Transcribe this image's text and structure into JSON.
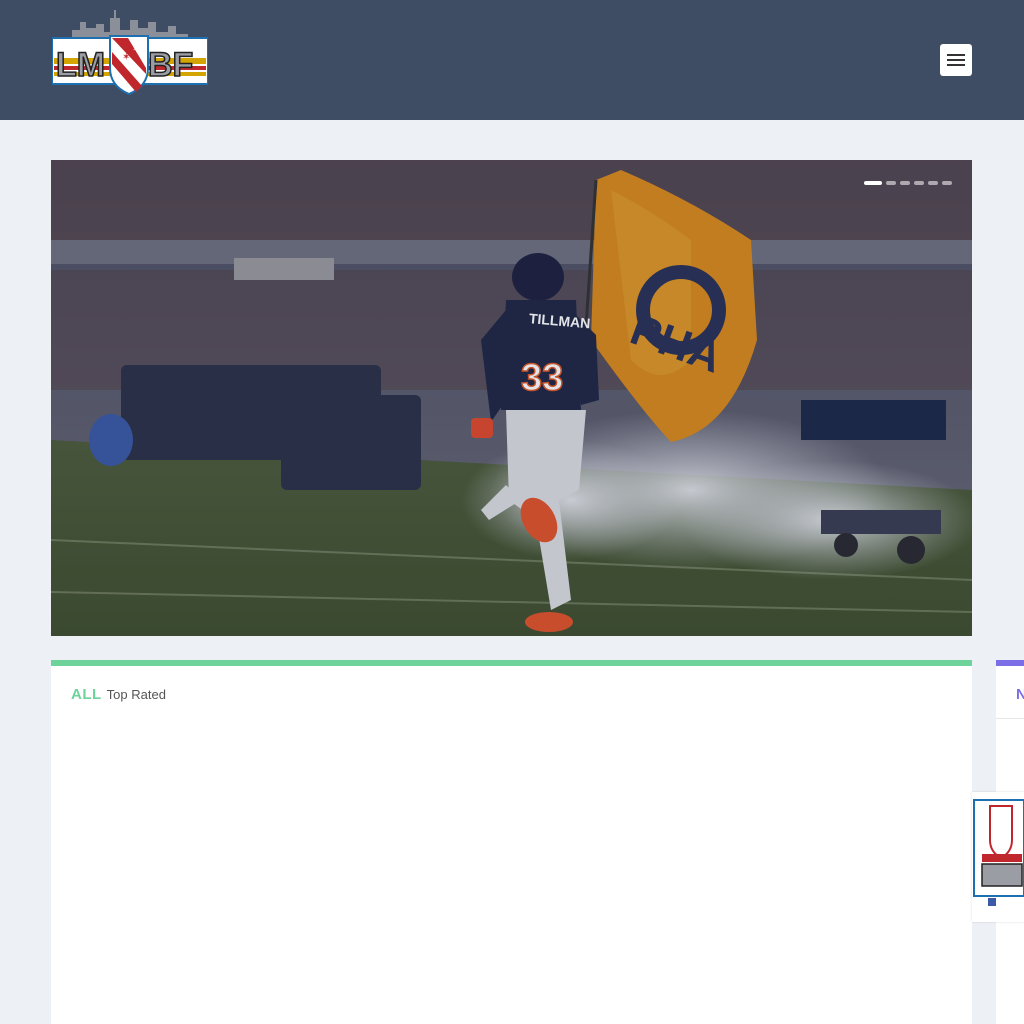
{
  "header": {
    "logo_text": "LMBF",
    "menu_icon": "hamburger-icon"
  },
  "hero": {
    "player_name": "TILLMAN",
    "player_number": "33",
    "slide_count": 6,
    "active_slide": 1
  },
  "panel": {
    "tab_label": "ALL",
    "subtitle": "Top Rated"
  },
  "panel2": {
    "label_partial": "N"
  },
  "colors": {
    "header_bg": "#3e4d63",
    "page_bg": "#edf0f5",
    "accent_green": "#6dd39a",
    "accent_purple": "#7b6ee6"
  }
}
